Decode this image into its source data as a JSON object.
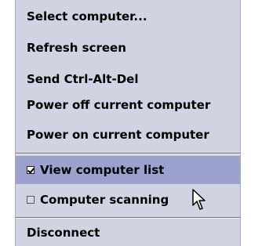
{
  "menu": {
    "items": [
      {
        "label": "Select computer..."
      },
      {
        "label": "Refresh screen"
      },
      {
        "label": "Send Ctrl-Alt-Del"
      },
      {
        "label": "Power off current computer"
      },
      {
        "label": "Power on current computer"
      }
    ],
    "toggles": [
      {
        "label": "View computer list",
        "checked": true,
        "highlighted": true
      },
      {
        "label": "Computer scanning",
        "checked": false,
        "highlighted": false
      }
    ],
    "disconnect_label": "Disconnect"
  },
  "colors": {
    "menu_bg": "#d0d3e2",
    "highlight_bg": "#9ca1cd",
    "separator_dark": "#6f7390",
    "separator_light": "#f2f3f8"
  },
  "cursor": {
    "icon": "arrow-cursor-icon"
  }
}
